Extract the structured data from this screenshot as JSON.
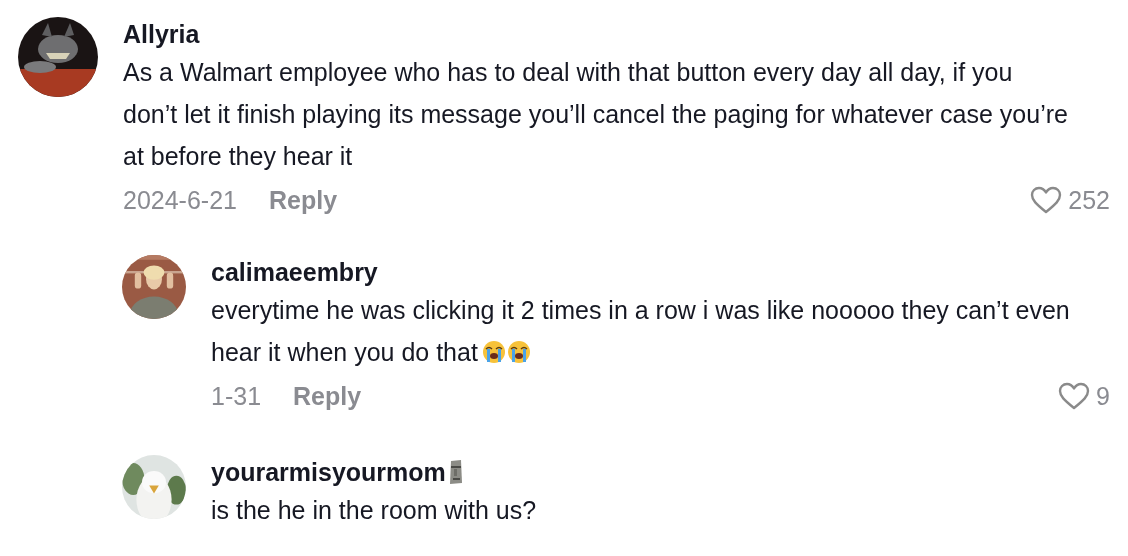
{
  "comments": [
    {
      "username": "Allyria",
      "text": "As a Walmart employee who has to deal with that button every day all day, if you don’t let it finish playing its message you’ll cancel the paging for whatever case you’re at before they hear it",
      "date": "2024-6-21",
      "reply_label": "Reply",
      "likes": "252",
      "liked": false,
      "children": [
        {
          "username": "calimaeembry",
          "text": "everytime he was clicking it 2 times in a row i was like nooooo they can’t even hear it when you do that",
          "date": "1-31",
          "reply_label": "Reply",
          "likes": "9",
          "liked": false
        },
        {
          "username": "yourarmisyourmom",
          "text": "is the he in the room with us?"
        }
      ]
    }
  ]
}
